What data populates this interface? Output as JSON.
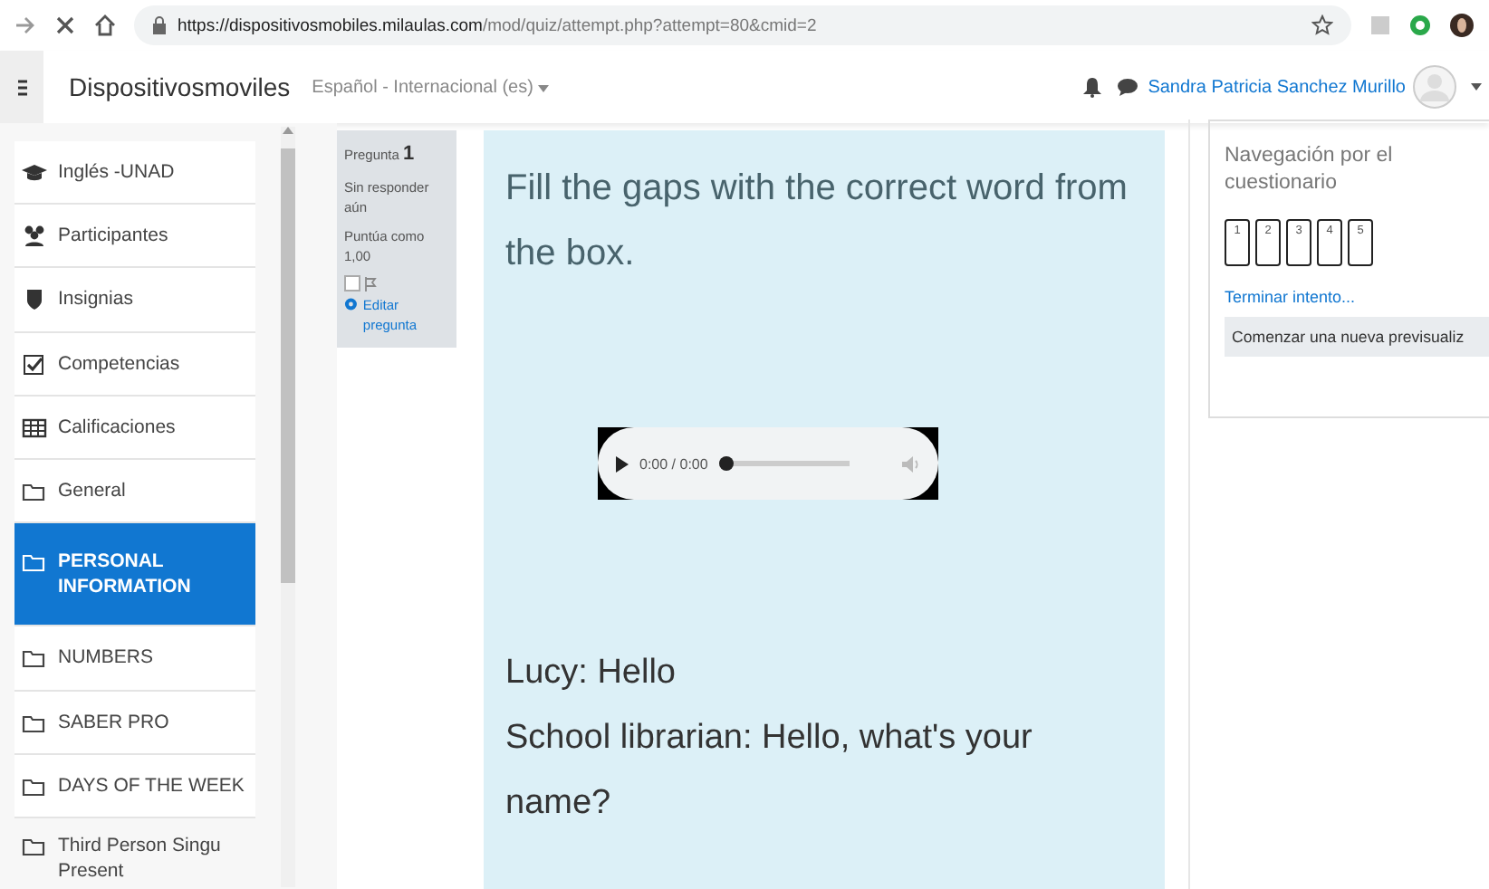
{
  "browser": {
    "url_host": "https://dispositivosmobiles.milaulas.com",
    "url_path": "/mod/quiz/attempt.php?attempt=80&cmid=2"
  },
  "navbar": {
    "site_name": "Dispositivosmoviles",
    "language": "Español - Internacional (es)",
    "user_name": "Sandra Patricia Sanchez Murillo"
  },
  "sidebar": {
    "items": [
      {
        "label": "Inglés -UNAD",
        "kind": "course",
        "selected": false
      },
      {
        "label": "Participantes",
        "kind": "participants",
        "selected": false
      },
      {
        "label": "Insignias",
        "kind": "badges",
        "selected": false
      },
      {
        "label": "Competencias",
        "kind": "competencies",
        "selected": false
      },
      {
        "label": "Calificaciones",
        "kind": "grades",
        "selected": false
      },
      {
        "label": "General",
        "kind": "section",
        "selected": false
      },
      {
        "label": "PERSONAL INFORMATION",
        "kind": "section",
        "selected": true
      },
      {
        "label": "NUMBERS",
        "kind": "section",
        "selected": false
      },
      {
        "label": "SABER PRO",
        "kind": "section",
        "selected": false
      },
      {
        "label": "DAYS OF THE WEEK",
        "kind": "section",
        "selected": false
      },
      {
        "label": "Third Person Singu Present",
        "kind": "section",
        "selected": false
      }
    ]
  },
  "question_info": {
    "label": "Pregunta",
    "number": "1",
    "status": "Sin responder aún",
    "mark": "Puntúa como 1,00",
    "flagged": false,
    "edit_link": "Editar pregunta"
  },
  "question": {
    "instruction": "Fill the gaps with the correct word from the box.",
    "audio": {
      "time": "0:00 / 0:00",
      "level": 0
    },
    "lines": [
      "Lucy: Hello",
      "School librarian: Hello, what's your name?"
    ]
  },
  "quiz_navigation": {
    "title": "Navegación por el cuestionario",
    "questions": [
      {
        "label": "1",
        "selected": false
      },
      {
        "label": "2",
        "selected": false
      },
      {
        "label": "3",
        "selected": false
      },
      {
        "label": "4",
        "selected": false
      },
      {
        "label": "5",
        "selected": false
      }
    ],
    "finish_link": "Terminar intento...",
    "restart_button": "Comenzar una nueva previsualiz"
  }
}
